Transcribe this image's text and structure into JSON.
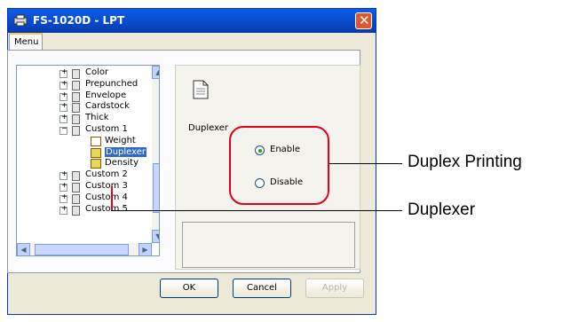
{
  "window": {
    "title": "FS-1020D - LPT",
    "close_label": "✕"
  },
  "tab": {
    "label": "Menu"
  },
  "tree": {
    "items": [
      {
        "label": "Color",
        "type": "folder"
      },
      {
        "label": "Prepunched",
        "type": "folder"
      },
      {
        "label": "Envelope",
        "type": "folder"
      },
      {
        "label": "Cardstock",
        "type": "folder"
      },
      {
        "label": "Thick",
        "type": "folder"
      },
      {
        "label": "Custom 1",
        "type": "folder-open"
      },
      {
        "label": "Weight",
        "type": "leaf"
      },
      {
        "label": "Duplexer",
        "type": "leaf-selected"
      },
      {
        "label": "Density",
        "type": "leaf"
      },
      {
        "label": "Custom 2",
        "type": "folder"
      },
      {
        "label": "Custom 3",
        "type": "folder"
      },
      {
        "label": "Custom 4",
        "type": "folder"
      },
      {
        "label": "Custom 5",
        "type": "folder"
      }
    ]
  },
  "settings": {
    "heading": "Duplexer",
    "options": [
      {
        "label": "Enable",
        "selected": true
      },
      {
        "label": "Disable",
        "selected": false
      }
    ]
  },
  "buttons": {
    "ok": "OK",
    "cancel": "Cancel",
    "apply": "Apply"
  },
  "callouts": {
    "duplex_printing": "Duplex Printing",
    "duplexer": "Duplexer"
  },
  "colors": {
    "highlight": "#e2001a",
    "selection": "#316ac5",
    "titlebar": "#0a5ee6"
  }
}
